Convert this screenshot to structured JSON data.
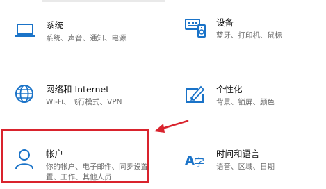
{
  "settings": {
    "tiles": [
      {
        "key": "system",
        "title": "系统",
        "desc": [
          "系统、声音、通知、电源"
        ],
        "icon": "laptop-icon"
      },
      {
        "key": "devices",
        "title": "设备",
        "desc": [
          "蓝牙、打印机、鼠标"
        ],
        "icon": "devices-icon"
      },
      {
        "key": "network",
        "title": "网络和 Internet",
        "desc": [
          "Wi-Fi、飞行模式、VPN"
        ],
        "icon": "globe-icon"
      },
      {
        "key": "personalization",
        "title": "个性化",
        "desc": [
          "背景、锁屏、颜色"
        ],
        "icon": "personalization-icon"
      },
      {
        "key": "accounts",
        "title": "帐户",
        "desc": [
          "你的帐户、电子邮件、同步设置",
          "置、工作、其他人员"
        ],
        "icon": "person-icon"
      },
      {
        "key": "time_language",
        "title": "时间和语言",
        "desc": [
          "语音、区域、日期"
        ],
        "icon": "time-language-icon"
      }
    ]
  },
  "colors": {
    "icon_blue": "#1a73c8",
    "annotation_red": "#d9232d"
  }
}
